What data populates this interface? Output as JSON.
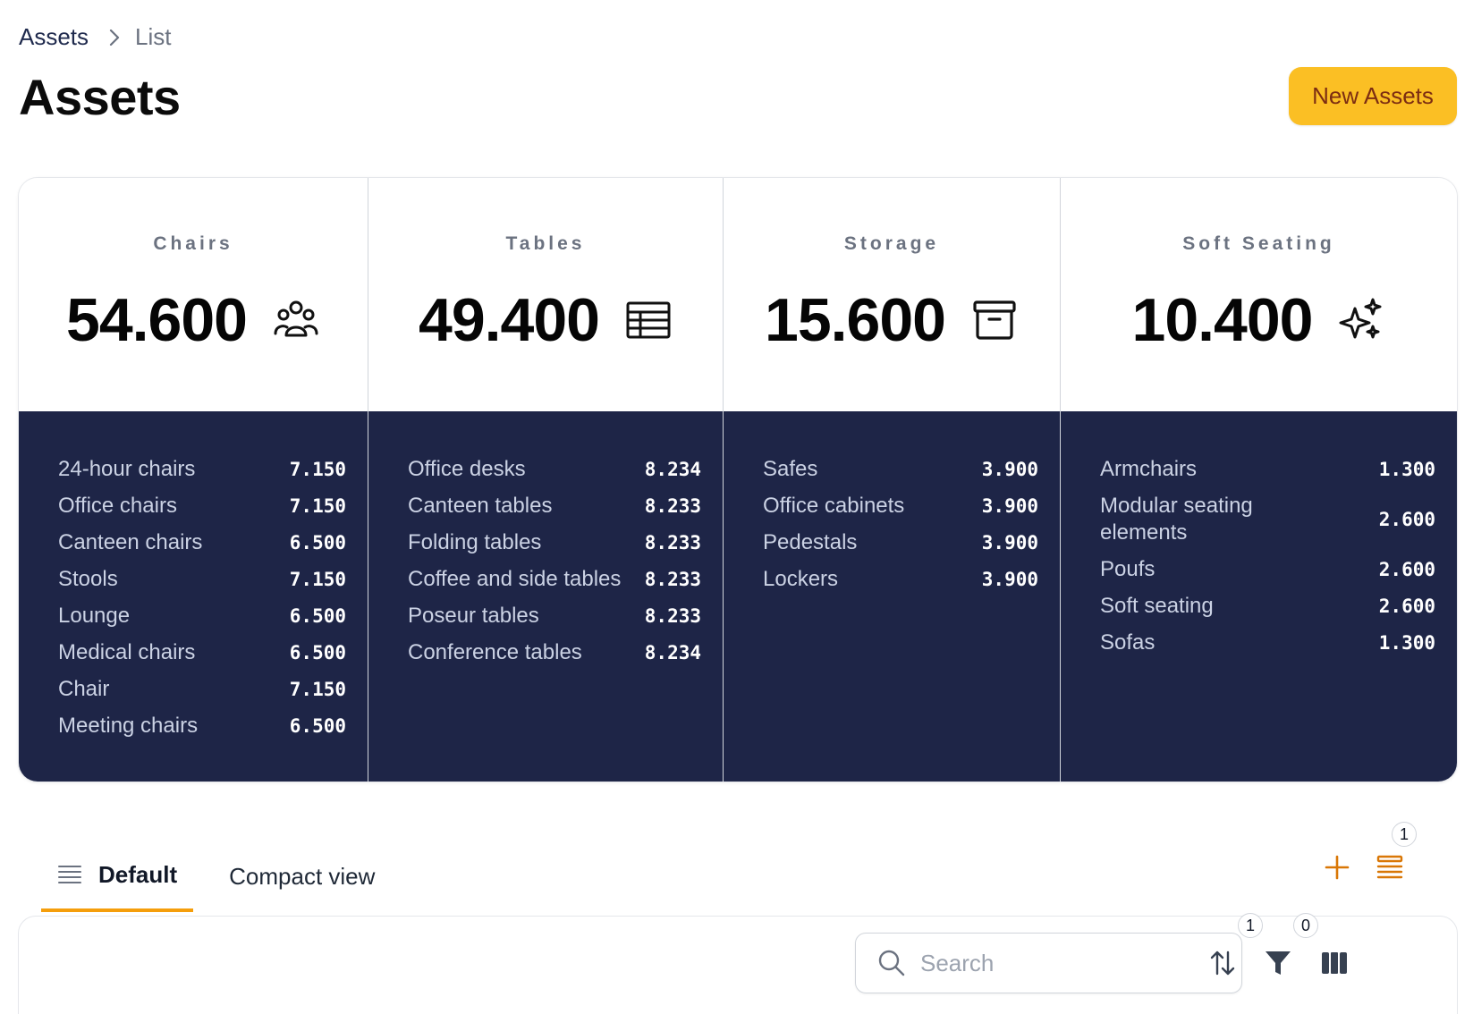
{
  "breadcrumb": {
    "parent": "Assets",
    "current": "List"
  },
  "page": {
    "title": "Assets",
    "new_button": "New Assets"
  },
  "stats": [
    {
      "label": "Chairs",
      "total": "54.600",
      "icon": "users-group-icon",
      "items": [
        {
          "name": "24-hour chairs",
          "value": "7.150"
        },
        {
          "name": "Office chairs",
          "value": "7.150"
        },
        {
          "name": "Canteen chairs",
          "value": "6.500"
        },
        {
          "name": "Stools",
          "value": "7.150"
        },
        {
          "name": "Lounge",
          "value": "6.500"
        },
        {
          "name": "Medical chairs",
          "value": "6.500"
        },
        {
          "name": "Chair",
          "value": "7.150"
        },
        {
          "name": "Meeting chairs",
          "value": "6.500"
        }
      ]
    },
    {
      "label": "Tables",
      "total": "49.400",
      "icon": "table-icon",
      "items": [
        {
          "name": "Office desks",
          "value": "8.234"
        },
        {
          "name": "Canteen tables",
          "value": "8.233"
        },
        {
          "name": "Folding tables",
          "value": "8.233"
        },
        {
          "name": "Coffee and side tables",
          "value": "8.233"
        },
        {
          "name": "Poseur tables",
          "value": "8.233"
        },
        {
          "name": "Conference tables",
          "value": "8.234"
        }
      ]
    },
    {
      "label": "Storage",
      "total": "15.600",
      "icon": "archive-box-icon",
      "items": [
        {
          "name": "Safes",
          "value": "3.900"
        },
        {
          "name": "Office cabinets",
          "value": "3.900"
        },
        {
          "name": "Pedestals",
          "value": "3.900"
        },
        {
          "name": "Lockers",
          "value": "3.900"
        }
      ]
    },
    {
      "label": "Soft Seating",
      "total": "10.400",
      "icon": "sparkles-icon",
      "items": [
        {
          "name": "Armchairs",
          "value": "1.300"
        },
        {
          "name": "Modular seating elements",
          "value": "2.600"
        },
        {
          "name": "Poufs",
          "value": "2.600"
        },
        {
          "name": "Soft seating",
          "value": "2.600"
        },
        {
          "name": "Sofas",
          "value": "1.300"
        }
      ]
    }
  ],
  "tabs": {
    "default": "Default",
    "compact": "Compact view"
  },
  "tab_actions": {
    "views_badge": "1"
  },
  "toolbar": {
    "search_placeholder": "Search",
    "sort_badge": "1",
    "filter_badge": "0"
  },
  "colors": {
    "accent": "#fbbf24",
    "panel": "#1e2547",
    "tab_underline": "#f59e0b"
  }
}
